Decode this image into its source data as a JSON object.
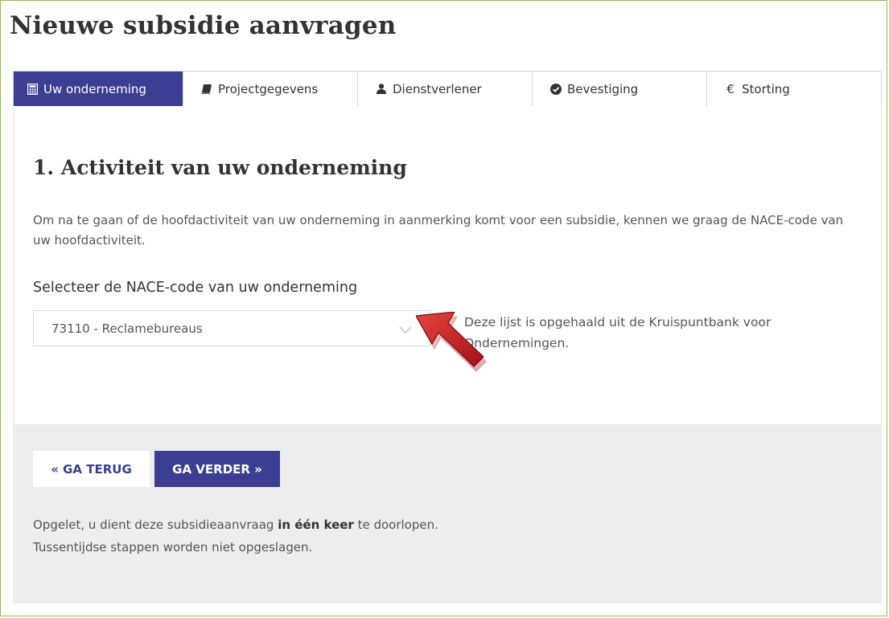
{
  "page": {
    "title": "Nieuwe subsidie aanvragen"
  },
  "tabs": [
    {
      "label": "Uw onderneming",
      "icon": "calculator-icon",
      "active": true
    },
    {
      "label": "Projectgegevens",
      "icon": "book-icon",
      "active": false
    },
    {
      "label": "Dienstverlener",
      "icon": "user-icon",
      "active": false
    },
    {
      "label": "Bevestiging",
      "icon": "check-circle-icon",
      "active": false
    },
    {
      "label": "Storting",
      "icon": "euro-icon",
      "symbol": "€",
      "active": false
    }
  ],
  "section": {
    "title": "1. Activiteit van uw onderneming",
    "intro": "Om na te gaan of de hoofdactiviteit van uw onderneming in aanmerking komt voor een subsidie, kennen we graag de NACE-code van uw hoofdactiviteit.",
    "select_label": "Selecteer de NACE-code van uw onderneming",
    "select_value": "73110 - Reclamebureaus",
    "note": "Deze lijst is opgehaald uit de Kruispuntbank voor Ondernemingen."
  },
  "footer": {
    "back_label": "« GA TERUG",
    "next_label": "GA VERDER »",
    "warning_pre": "Opgelet, u dient deze subsidieaanvraag ",
    "warning_bold": "in één keer",
    "warning_post": " te doorlopen.",
    "warning_line2": "Tussentijdse stappen worden niet opgeslagen."
  },
  "colors": {
    "accent": "#3b3e92",
    "frame_border": "#8cc63f",
    "footer_bg": "#ededed",
    "annotation_arrow": "#c0161c"
  }
}
